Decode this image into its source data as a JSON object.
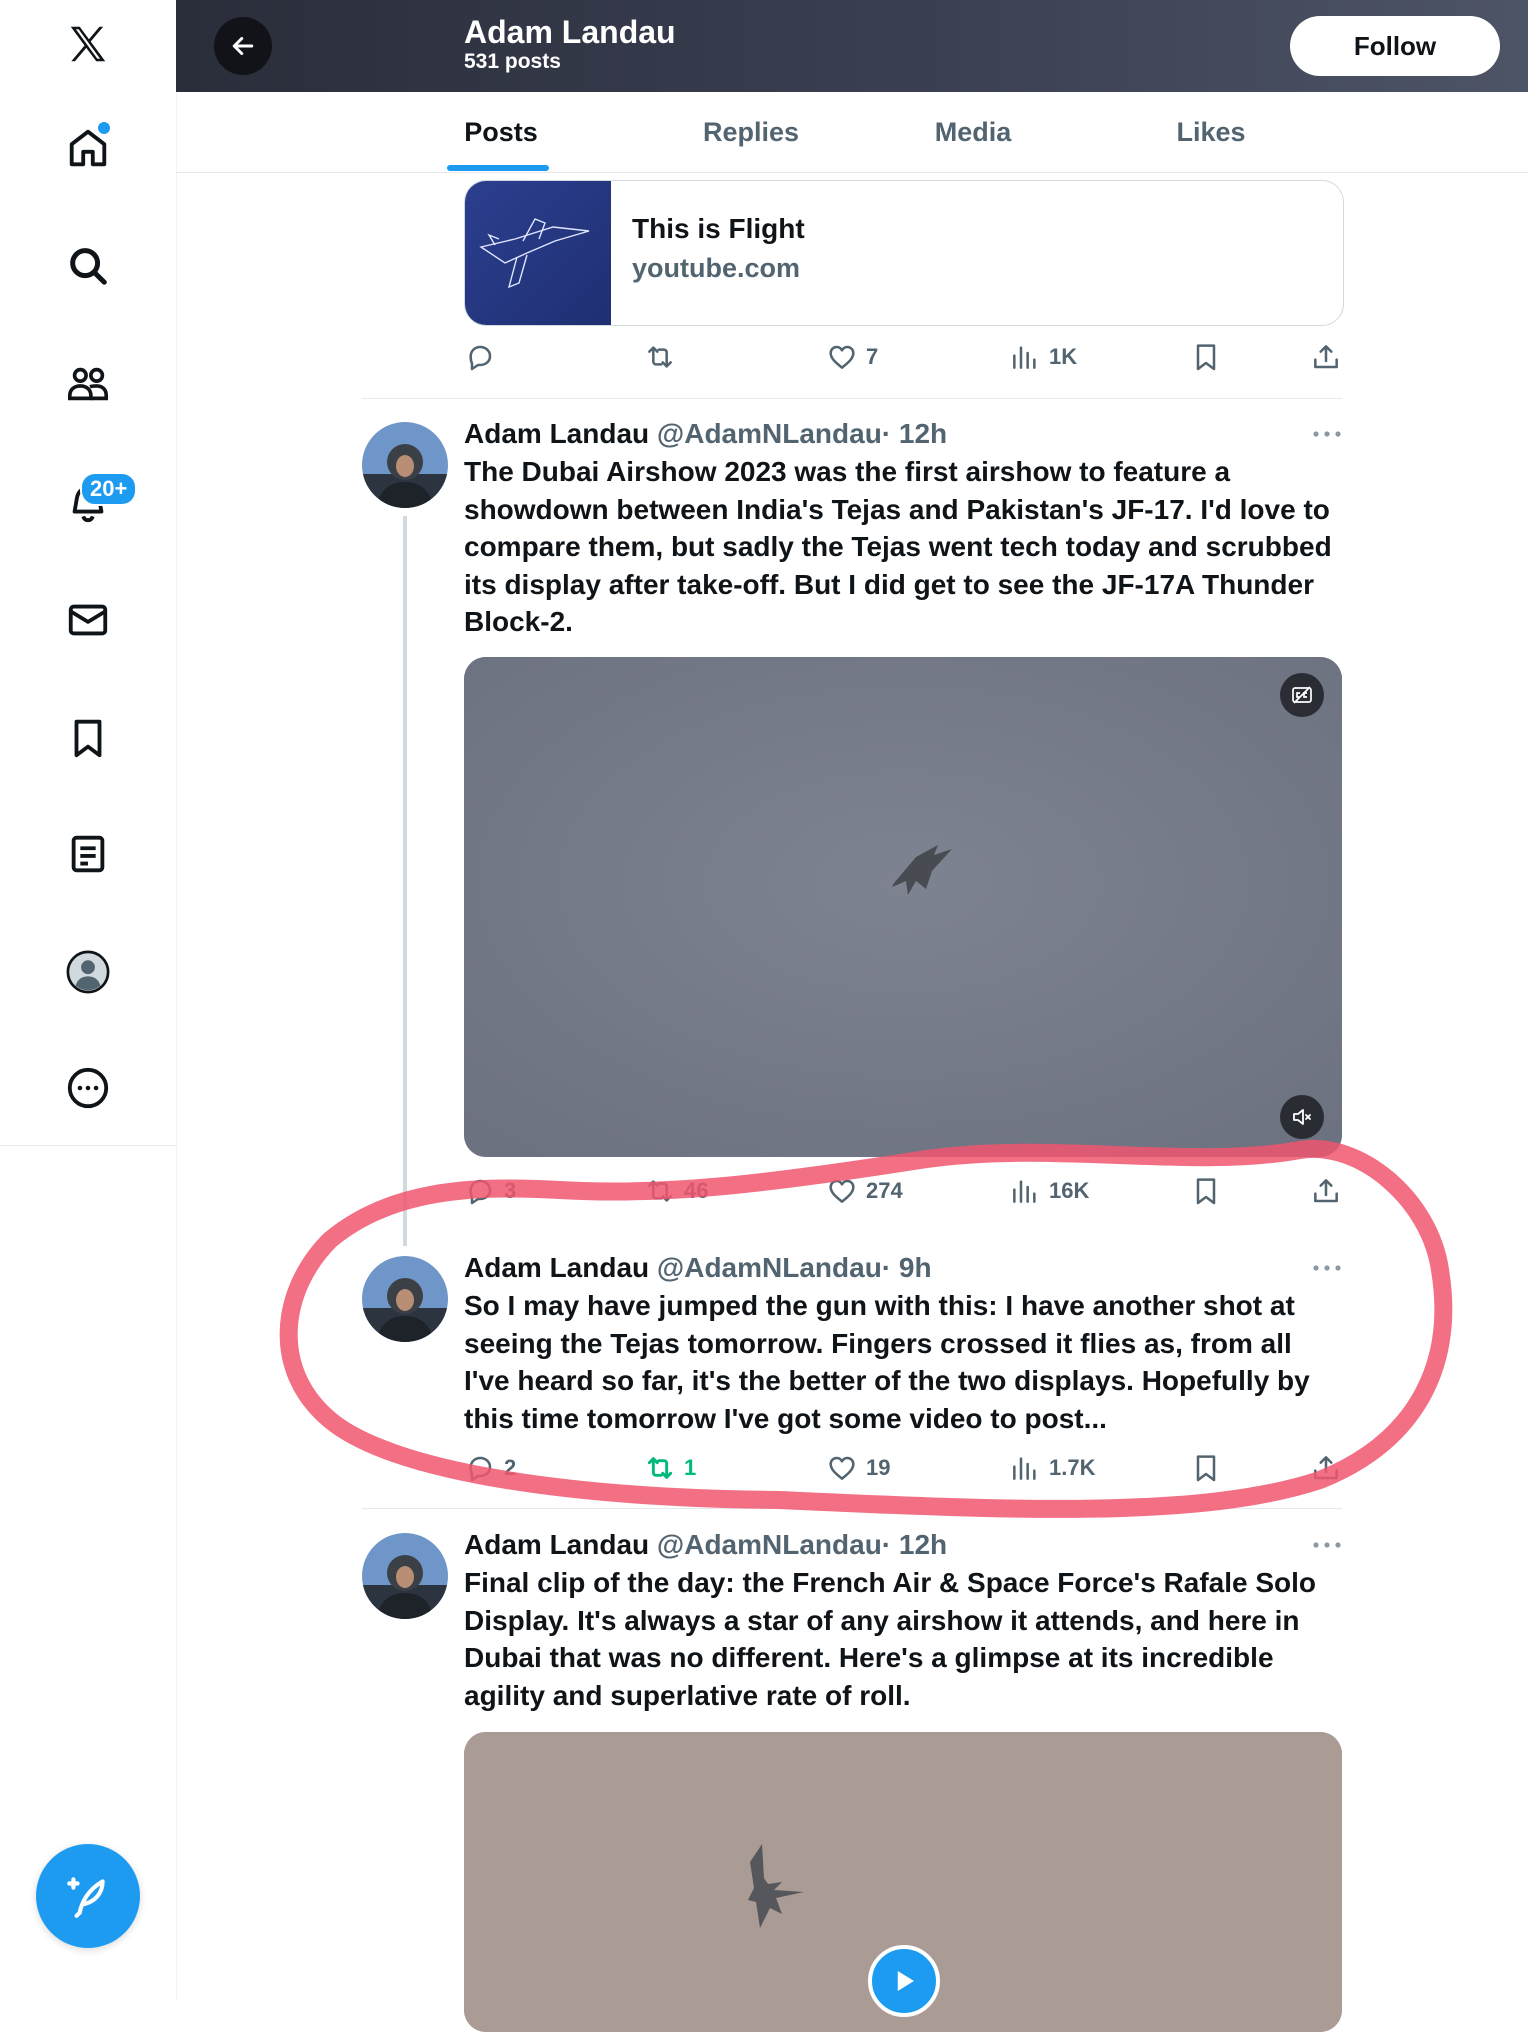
{
  "header": {
    "name": "Adam Landau",
    "post_count": "531 posts",
    "follow_label": "Follow"
  },
  "tabs": [
    {
      "label": "Posts",
      "active": true
    },
    {
      "label": "Replies"
    },
    {
      "label": "Media"
    },
    {
      "label": "Likes"
    }
  ],
  "sidebar": {
    "items": [
      "x-logo-icon",
      "home-icon",
      "search-icon",
      "communities-icon",
      "notifications-icon",
      "messages-icon",
      "bookmarks-icon",
      "lists-icon",
      "profile-icon",
      "more-icon"
    ],
    "notifications_badge": "20+"
  },
  "link_card": {
    "title": "This is Flight",
    "domain": "youtube.com",
    "actions": {
      "replies": "",
      "reposts": "",
      "likes": "7",
      "views": "1K"
    }
  },
  "posts": [
    {
      "name": "Adam Landau",
      "handle": "@AdamNLandau",
      "time": "· 12h",
      "text": "The Dubai Airshow 2023 was the first airshow to feature a showdown between India's Tejas and Pakistan's JF-17. I'd love to compare them, but sadly the Tejas went tech today and scrubbed its display after take-off. But I did get to see the JF-17A Thunder Block-2.",
      "actions": {
        "replies": "3",
        "reposts": "46",
        "likes": "274",
        "views": "16K"
      }
    },
    {
      "name": "Adam Landau",
      "handle": "@AdamNLandau",
      "time": "· 9h",
      "text": "So I may have jumped the gun with this: I have another shot at seeing the Tejas tomorrow. Fingers crossed it flies as, from all I've heard so far, it's the better of the two displays. Hopefully by this time tomorrow I've got some video to post...",
      "actions": {
        "replies": "2",
        "reposts": "1",
        "likes": "19",
        "views": "1.7K"
      }
    },
    {
      "name": "Adam Landau",
      "handle": "@AdamNLandau",
      "time": "· 12h",
      "text": "Final clip of the day: the French Air & Space Force's Rafale Solo Display. It's always a star of any airshow it attends, and here in Dubai that was no different. Here's a glimpse at its incredible agility and superlative rate of roll."
    }
  ],
  "colors": {
    "accent": "#1d9bf0",
    "repost_active": "#00ba7c",
    "annotation": "#f0566e"
  }
}
